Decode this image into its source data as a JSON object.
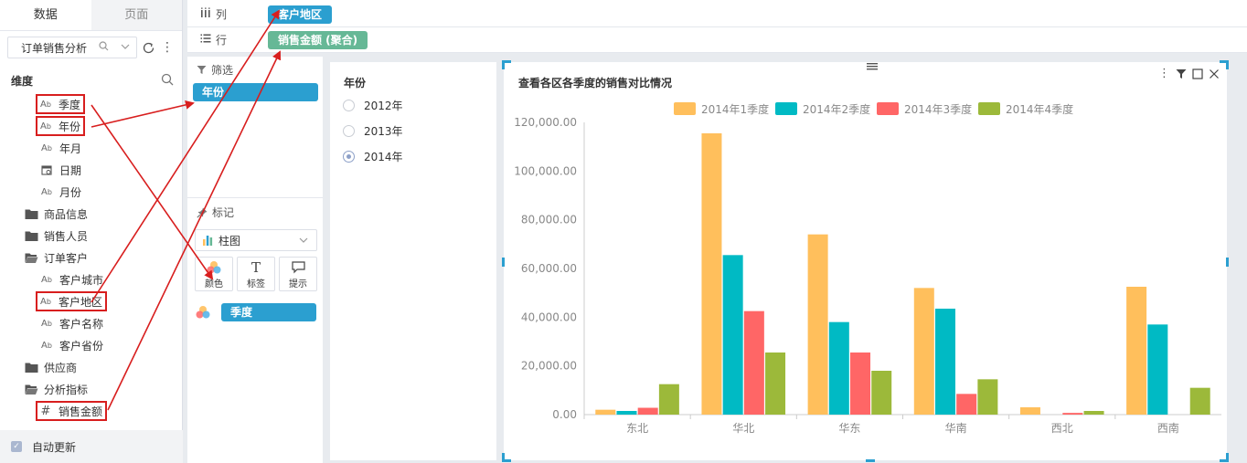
{
  "panel_tabs": [
    "数据",
    "页面"
  ],
  "dataset": "订单销售分析",
  "dimensions_title": "维度",
  "tree": [
    {
      "label": "季度",
      "level": 1,
      "icon": "text-field-icon",
      "boxed": true
    },
    {
      "label": "年份",
      "level": 1,
      "icon": "text-field-icon",
      "boxed": true
    },
    {
      "label": "年月",
      "level": 1,
      "icon": "text-field-icon",
      "boxed": false
    },
    {
      "label": "日期",
      "level": 1,
      "icon": "date-field-icon",
      "boxed": false
    },
    {
      "label": "月份",
      "level": 1,
      "icon": "text-field-icon",
      "boxed": false
    },
    {
      "label": "商品信息",
      "level": 0,
      "icon": "folder-icon",
      "boxed": false
    },
    {
      "label": "销售人员",
      "level": 0,
      "icon": "folder-icon",
      "boxed": false
    },
    {
      "label": "订单客户",
      "level": 0,
      "icon": "folder-open-icon",
      "boxed": false
    },
    {
      "label": "客户城市",
      "level": 1,
      "icon": "text-field-icon",
      "boxed": false
    },
    {
      "label": "客户地区",
      "level": 1,
      "icon": "text-field-icon",
      "boxed": true
    },
    {
      "label": "客户名称",
      "level": 1,
      "icon": "text-field-icon",
      "boxed": false
    },
    {
      "label": "客户省份",
      "level": 1,
      "icon": "text-field-icon",
      "boxed": false
    },
    {
      "label": "供应商",
      "level": 0,
      "icon": "folder-icon",
      "boxed": false
    },
    {
      "label": "分析指标",
      "level": 0,
      "icon": "folder-open-icon",
      "boxed": false
    },
    {
      "label": "销售金额",
      "level": 1,
      "icon": "measure-field-icon",
      "boxed": true
    }
  ],
  "auto_update": "自动更新",
  "shelves": {
    "columns_label": "列",
    "columns_pill": "客户地区",
    "rows_label": "行",
    "rows_pill": "销售金额 (聚合)"
  },
  "config": {
    "filter_label": "筛选",
    "filter_pill": "年份",
    "mark_label": "标记",
    "chart_type": "柱图",
    "mark_buttons": [
      "颜色",
      "标签",
      "提示"
    ],
    "color_pill": "季度"
  },
  "year_filter": {
    "title": "年份",
    "options": [
      "2012年",
      "2013年",
      "2014年"
    ],
    "selected": "2014年"
  },
  "colors": {
    "q1": "#ffbf5c",
    "q2": "#00bac4",
    "q3": "#ff6666",
    "q4": "#9cb93a",
    "annotation": "#d81e1e",
    "pill_blue": "#2b9fd0",
    "pill_green": "#66b896"
  },
  "chart_data": {
    "type": "bar",
    "title": "查看各区各季度的销售对比情况",
    "categories": [
      "东北",
      "华北",
      "华东",
      "华南",
      "西北",
      "西南"
    ],
    "series": [
      {
        "name": "2014年1季度",
        "values": [
          2000,
          115500,
          74000,
          52000,
          3000,
          52500
        ]
      },
      {
        "name": "2014年2季度",
        "values": [
          1500,
          65500,
          38000,
          43500,
          0,
          37000
        ]
      },
      {
        "name": "2014年3季度",
        "values": [
          2800,
          42500,
          25500,
          8500,
          700,
          0
        ]
      },
      {
        "name": "2014年4季度",
        "values": [
          12500,
          25500,
          18000,
          14500,
          1500,
          11000
        ]
      }
    ],
    "y_ticks": [
      "0.00",
      "20,000.00",
      "40,000.00",
      "60,000.00",
      "80,000.00",
      "100,000.00",
      "120,000.00"
    ],
    "ylim": [
      0,
      120000
    ],
    "legend": "top-center",
    "grid": false
  }
}
